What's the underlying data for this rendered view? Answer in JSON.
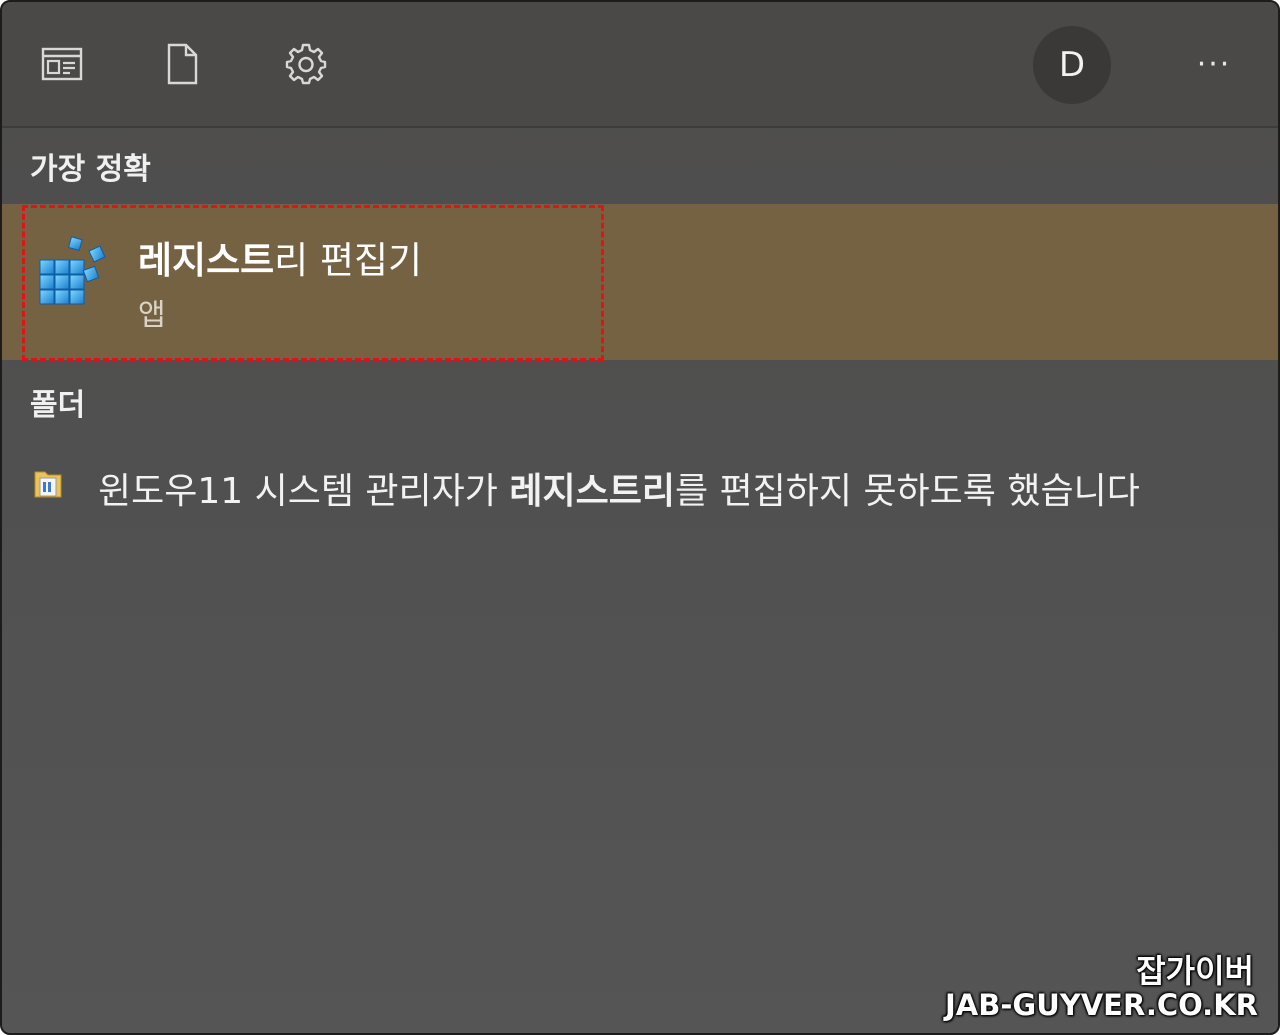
{
  "toolbar": {
    "icons": [
      "apps-view-icon",
      "documents-icon",
      "settings-gear-icon"
    ],
    "avatar_letter": "D",
    "more_label": "···"
  },
  "best_match": {
    "heading": "가장 정확",
    "app_name_bold": "레지스트",
    "app_name_rest": "리 편집기",
    "app_type": "앱",
    "highlight_color": "#e01414",
    "background_color": "#756243"
  },
  "folders": {
    "heading": "폴더",
    "items": [
      {
        "text_before": "윈도우11 시스템 관리자가 ",
        "text_bold": "레지스트리",
        "text_after": "를 편집하지 못하도록 했습니다"
      }
    ]
  },
  "watermark": {
    "korean": "잡가이버",
    "domain": "JAB-GUYVER.CO.KR"
  }
}
